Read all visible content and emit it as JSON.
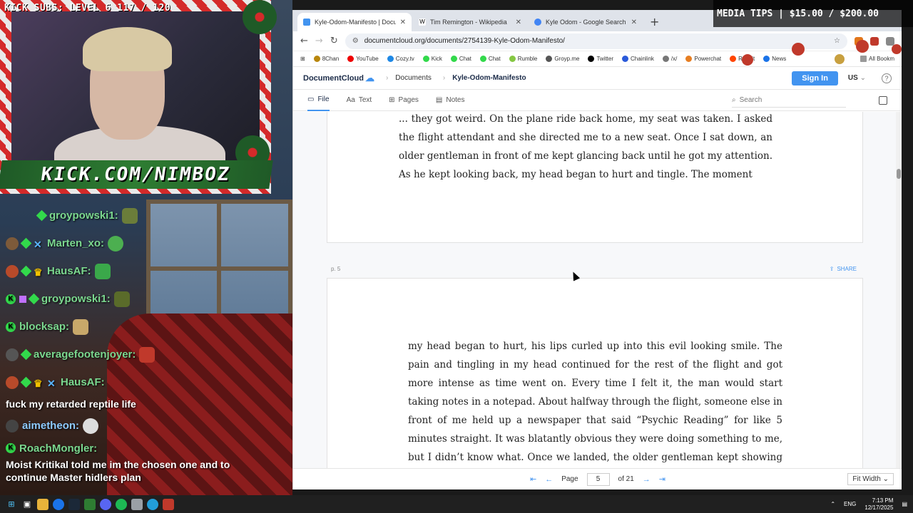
{
  "stream": {
    "sub_counter": "KICK SUBS: LEVEL 6 117 / 120",
    "banner": "KICK.COM/NIMBOZ",
    "media_tips": "MEDIA TIPS | $15.00 / $200.00",
    "chat": [
      {
        "user": "groypowski1:",
        "type": "name"
      },
      {
        "user": "Marten_xo:",
        "type": "name"
      },
      {
        "user": "HausAF:",
        "type": "name"
      },
      {
        "user": "groypowski1:",
        "type": "name"
      },
      {
        "user": "blocksap:",
        "type": "name"
      },
      {
        "user": "averagefootenjoyer:",
        "type": "name"
      },
      {
        "user": "HausAF:",
        "type": "name"
      },
      {
        "message": "fuck my retarded reptile life"
      },
      {
        "user": "aimetheon:",
        "type": "name"
      },
      {
        "user": "RoachMongler:",
        "type": "name"
      },
      {
        "message": "Moist Kritikal told me im the chosen one and to continue Master hidlers plan"
      }
    ]
  },
  "browser": {
    "tabs": [
      {
        "title": "Kyle-Odom-Manifesto | Docum",
        "active": true
      },
      {
        "title": "Tim Remington - Wikipedia",
        "active": false
      },
      {
        "title": "Kyle Odom - Google Search",
        "active": false
      }
    ],
    "new_tab": "+",
    "url": "documentcloud.org/documents/2754139-Kyle-Odom-Manifesto/",
    "bookmarks": [
      "8Chan",
      "YouTube",
      "Cozy.tv",
      "Kick",
      "Chat",
      "Chat",
      "Rumble",
      "Groyp.me",
      "Twitter",
      "Chainlink",
      "/x/",
      "Powerchat",
      "Reddit",
      "News"
    ],
    "all_bookmarks": "All Bookm"
  },
  "dc": {
    "logo": "DocumentCloud",
    "breadcrumb": "Documents",
    "title": "Kyle-Odom-Manifesto",
    "sign_in": "Sign In",
    "lang": "US",
    "help": "?",
    "tabs": [
      "File",
      "Text",
      "Pages",
      "Notes"
    ],
    "search_placeholder": "Search",
    "page_top_text": "... they got weird. On the plane ride back home, my seat was taken. I asked the flight attendant and she directed me to a new seat. Once I sat down, an older gentleman in front of me kept glancing back until he got my attention. As he kept looking back, my head began to hurt and tingle. The moment",
    "page_label": "p. 5",
    "share": "SHARE",
    "page_5_text": "my head began to hurt, his lips curled up into this evil looking smile. The pain and tingling in my head continued for the rest of the flight and got more intense as time went on. Every time I felt it, the man would start taking notes in a notepad. About halfway through the flight, someone else in front of me held up a newspaper that said “Psychic Reading” for like 5 minutes straight. It was blatantly obvious they were doing something to me, but I didn’t know what. Once we landed, the older gentleman kept showing me his TracFone as if to say “Get one of these”.",
    "pager": {
      "label": "Page",
      "current": "5",
      "of": "of 21",
      "zoom": "Fit Width"
    }
  },
  "taskbar": {
    "lang": "ENG",
    "time": "7:13 PM",
    "date": "12/17/2025"
  },
  "colors": {
    "accent": "#4294f0",
    "chat_green": "#7bd88f",
    "kick_green": "#32d94b"
  }
}
